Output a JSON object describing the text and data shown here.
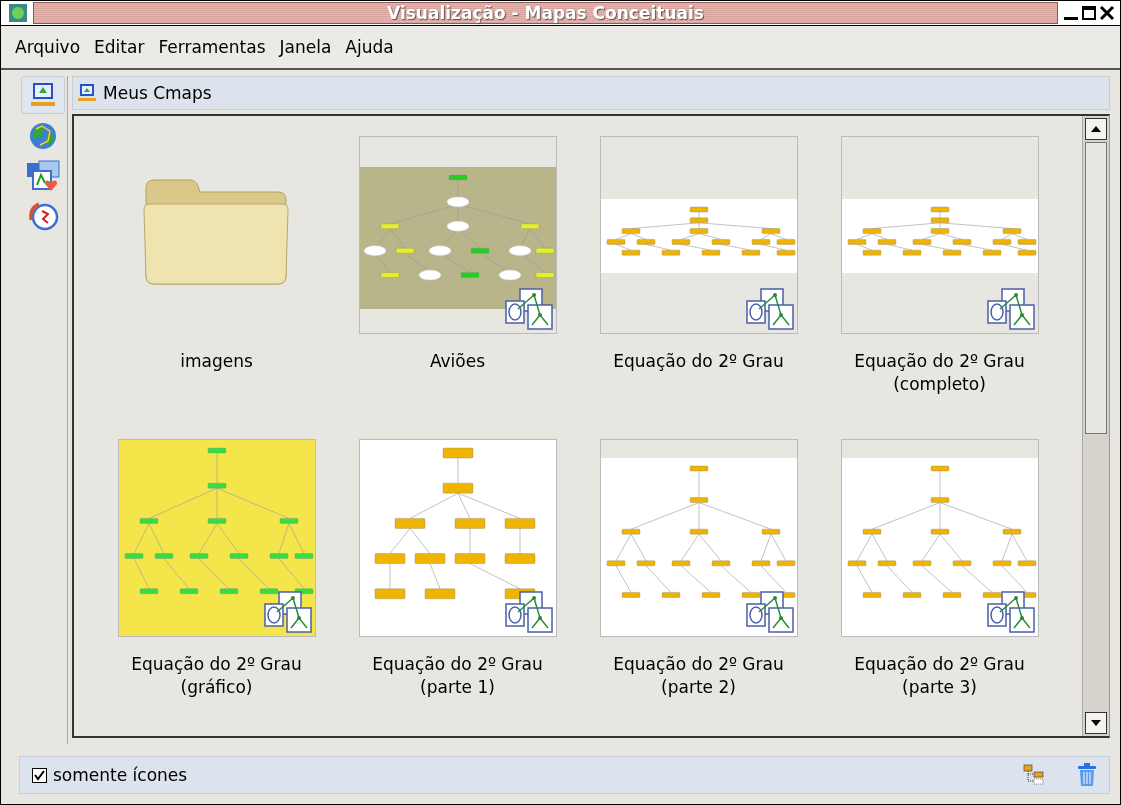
{
  "window": {
    "title": "Visualização - Mapas Conceituais"
  },
  "menu": [
    {
      "label": "Arquivo"
    },
    {
      "label": "Editar"
    },
    {
      "label": "Ferramentas"
    },
    {
      "label": "Janela"
    },
    {
      "label": "Ajuda"
    }
  ],
  "sidebar": {
    "items": [
      {
        "selected": true
      },
      {
        "selected": false
      },
      {
        "selected": false
      },
      {
        "selected": false
      }
    ]
  },
  "panel": {
    "title": "Meus Cmaps"
  },
  "items": [
    {
      "kind": "folder",
      "label": "imagens"
    },
    {
      "kind": "textured",
      "label": "Aviões"
    },
    {
      "kind": "banded",
      "label": "Equação do 2º Grau"
    },
    {
      "kind": "banded",
      "label": "Equação do 2º Grau (completo)"
    },
    {
      "kind": "yellow",
      "label": "Equação do 2º Grau (gráfico)"
    },
    {
      "kind": "large",
      "label": "Equação do 2º Grau (parte 1)"
    },
    {
      "kind": "white",
      "label": "Equação do 2º Grau (parte 2)"
    },
    {
      "kind": "white",
      "label": "Equação do 2º Grau (parte 3)"
    }
  ],
  "footer": {
    "checkbox": {
      "label": "somente ícones",
      "checked": true
    }
  }
}
